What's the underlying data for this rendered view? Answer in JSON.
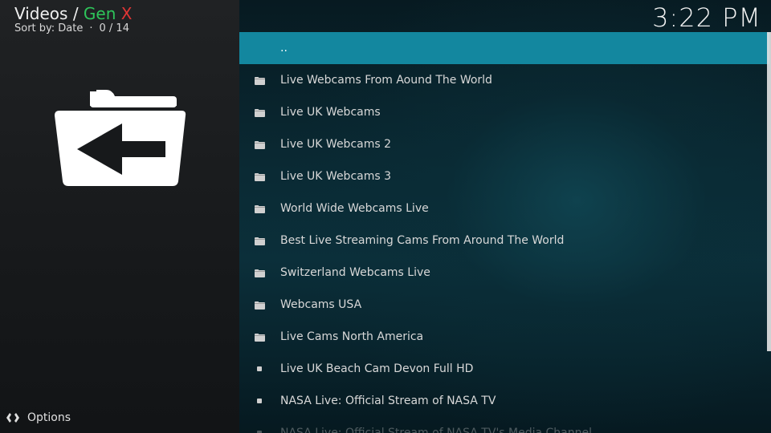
{
  "header": {
    "title_prefix": "Videos",
    "title_sep": " / ",
    "title_accent": "Gen",
    "title_accent_2": "X",
    "sort_label": "Sort by: Date",
    "position": "0 / 14",
    "clock": "3:22 PM"
  },
  "colors": {
    "accent_green": "#2ec45a",
    "accent_red": "#e03535",
    "selection": "#13879f"
  },
  "list": {
    "items": [
      {
        "label": "..",
        "icon": "none",
        "selected": true
      },
      {
        "label": "Live Webcams From Aound The World",
        "icon": "folder-icon"
      },
      {
        "label": "Live UK Webcams",
        "icon": "folder-icon"
      },
      {
        "label": "Live UK Webcams 2",
        "icon": "folder-icon"
      },
      {
        "label": "Live UK Webcams 3",
        "icon": "folder-icon"
      },
      {
        "label": "World Wide Webcams Live",
        "icon": "folder-icon"
      },
      {
        "label": "Best Live Streaming Cams From Around The World",
        "icon": "folder-icon"
      },
      {
        "label": "Switzerland Webcams Live",
        "icon": "folder-icon"
      },
      {
        "label": "Webcams USA",
        "icon": "folder-icon"
      },
      {
        "label": "Live Cams North America",
        "icon": "folder-icon"
      },
      {
        "label": "Live UK Beach Cam Devon Full HD",
        "icon": "bullet-icon"
      },
      {
        "label": "NASA Live: Official Stream of NASA TV",
        "icon": "bullet-icon"
      },
      {
        "label": "NASA Live: Official Stream of NASA TV's Media Channel",
        "icon": "bullet-icon",
        "faded": true
      }
    ]
  },
  "footer": {
    "options_label": "Options"
  },
  "icons": {
    "back_folder": "folder-back-icon",
    "options": "options-icon"
  }
}
